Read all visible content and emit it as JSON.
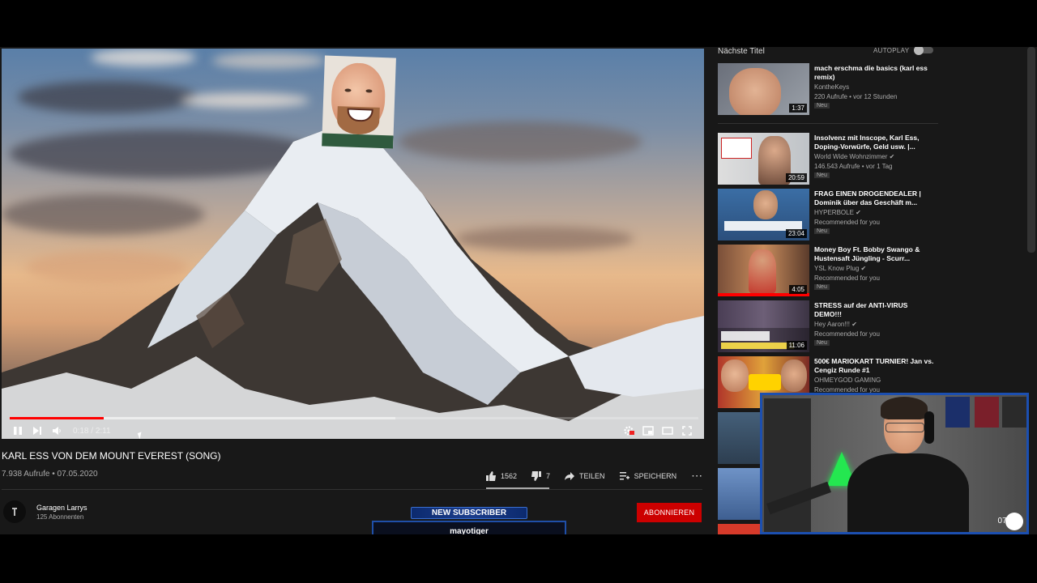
{
  "player": {
    "current_time": "0:18",
    "duration": "2:11",
    "time_separator": " / ",
    "progress_fraction": 0.137,
    "buffered_fraction": 0.56
  },
  "video": {
    "title": "KARL ESS VON DEM MOUNT EVEREST (SONG)",
    "meta": "7.938 Aufrufe • 07.05.2020",
    "likes": "1562",
    "dislikes": "7",
    "share_label": "TEILEN",
    "save_label": "SPEICHERN",
    "more_label": "⋯"
  },
  "channel": {
    "name": "Garagen Larrys",
    "subscribers": "125 Abonnenten",
    "subscribe_label": "ABONNIEREN"
  },
  "alert": {
    "title": "NEW SUBSCRIBER",
    "name": "mayotiger"
  },
  "sidebar": {
    "up_next_label": "Nächste Titel",
    "autoplay_label": "AUTOPLAY",
    "items": [
      {
        "title": "mach erschma die basics (karl ess remix)",
        "channel": "KontheKeys",
        "views": "220 Aufrufe • vor 12 Stunden",
        "badge": "Neu",
        "duration": "1:37"
      },
      {
        "title": "Insolvenz mit Inscope, Karl Ess, Doping-Vorwürfe, Geld usw. |...",
        "channel": "World Wide Wohnzimmer ✔",
        "views": "146.543 Aufrufe • vor 1 Tag",
        "badge": "Neu",
        "duration": "20:59"
      },
      {
        "title": "FRAG EINEN DROGENDEALER | Dominik über das Geschäft m...",
        "channel": "HYPERBOLE ✔",
        "views": "Recommended for you",
        "badge": "Neu",
        "duration": "23:04"
      },
      {
        "title": "Money Boy Ft. Bobby Swango & Hustensaft Jüngling - Scurr...",
        "channel": "YSL Know Plug ✔",
        "views": "Recommended for you",
        "badge": "Neu",
        "duration": "4:05"
      },
      {
        "title": "STRESS auf der ANTI-VIRUS DEMO!!!",
        "channel": "Hey Aaron!!! ✔",
        "views": "Recommended for you",
        "badge": "Neu",
        "duration": "11:06"
      },
      {
        "title": "500€ MARIOKART TURNIER! Jan vs. Cengiz Runde #1",
        "channel": "OHMEYGOD GAMING",
        "views": "Recommended for you",
        "badge": "",
        "duration": ""
      }
    ]
  },
  "webcam": {
    "timestamp": "07:5"
  },
  "colors": {
    "accent_red": "#cc0000",
    "progress_red": "#ff0000",
    "alert_blue": "#1f4fa8",
    "background": "#181818"
  }
}
